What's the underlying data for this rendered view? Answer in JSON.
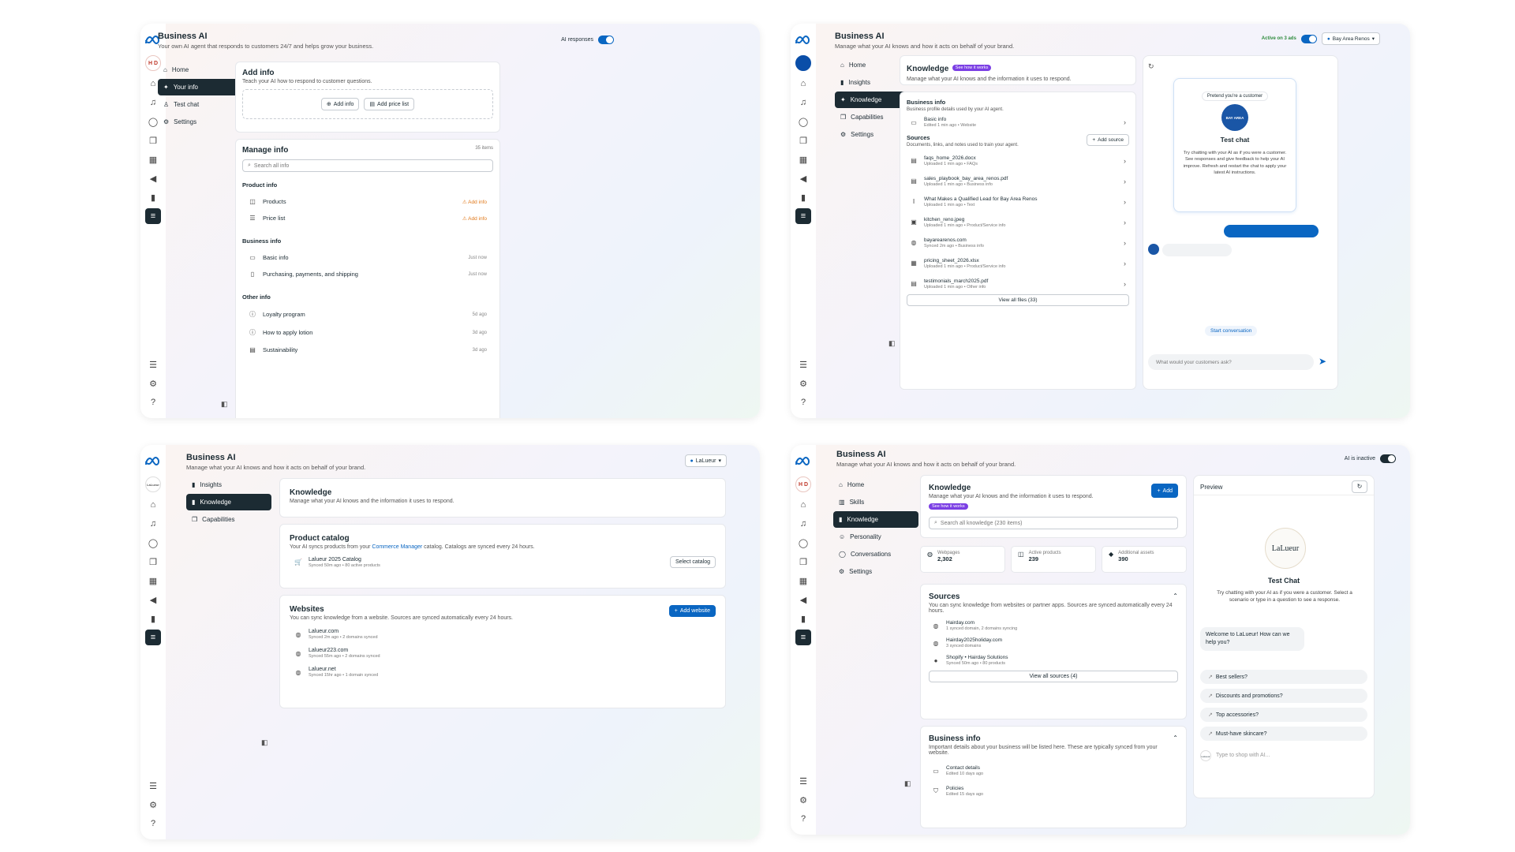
{
  "rail": {
    "avatar": "H D",
    "avatar_p3": "LaLueur"
  },
  "p1": {
    "title": "Business AI",
    "subtitle": "Your own AI agent that responds to customers 24/7 and helps grow your business.",
    "toggle_label": "AI responses",
    "nav": [
      "Home",
      "Your info",
      "Test chat",
      "Settings"
    ],
    "add_info": {
      "title": "Add info",
      "subtitle": "Teach your AI how to respond to customer questions.",
      "btn1": "Add info",
      "btn2": "Add price list"
    },
    "manage": {
      "title": "Manage info",
      "count": "35 items",
      "search": "Search all info",
      "sec1": "Product info",
      "products": "Products",
      "price_list": "Price list",
      "add_info": "Add info",
      "sec2": "Business info",
      "basic": "Basic info",
      "purchasing": "Purchasing, payments, and shipping",
      "just_now": "Just now",
      "sec3": "Other info",
      "loyalty": "Loyalty program",
      "loyalty_t": "5d ago",
      "lotion": "How to apply lotion",
      "lotion_t": "3d ago",
      "sust": "Sustainability",
      "sust_t": "3d ago"
    }
  },
  "p2": {
    "title": "Business AI",
    "subtitle": "Manage what your AI knows and how it acts on behalf of your brand.",
    "active": "Active on 3 ads",
    "page": "Bay Area Renos",
    "nav": [
      "Home",
      "Insights",
      "Knowledge",
      "Capabilities",
      "Settings"
    ],
    "knowledge": {
      "title": "Knowledge",
      "pill": "See how it works",
      "subtitle": "Manage what your AI knows and the information it uses to respond."
    },
    "bizinfo": {
      "title": "Business info",
      "subtitle": "Business profile details used by your AI agent.",
      "basic": "Basic info",
      "basic_sub": "Edited 1 min ago • Website"
    },
    "sources": {
      "title": "Sources",
      "subtitle": "Documents, links, and notes used to train your agent.",
      "add": "Add source",
      "items": [
        {
          "name": "faqs_home_2026.docx",
          "sub": "Uploaded 1 min ago • FAQs"
        },
        {
          "name": "sales_playbook_bay_area_renos.pdf",
          "sub": "Uploaded 1 min ago • Business info"
        },
        {
          "name": "What Makes a Qualified Lead for Bay Area Renos",
          "sub": "Uploaded 1 min ago • Text"
        },
        {
          "name": "kitchen_reno.jpeg",
          "sub": "Uploaded 1 min ago • Product/Service info"
        },
        {
          "name": "bayarearenos.com",
          "sub": "Synced 2m ago • Business info"
        },
        {
          "name": "pricing_sheet_2026.xlsx",
          "sub": "Uploaded 1 min ago • Product/Service info"
        },
        {
          "name": "testimonials_march2025.pdf",
          "sub": "Uploaded 1 min ago • Other info"
        }
      ],
      "view_all": "View all files (33)"
    },
    "chat": {
      "pretend": "Pretend you're a customer",
      "brand": "BAY AREA",
      "title": "Test chat",
      "desc": "Try chatting with your AI as if you were a customer. See responses and give feedback to help your AI improve. Refresh and restart the chat to apply your latest AI instructions.",
      "start": "Start conversation",
      "input": "What would your customers ask?"
    }
  },
  "p3": {
    "title": "Business AI",
    "subtitle": "Manage what your AI knows and how it acts on behalf of your brand.",
    "page": "LaLueur",
    "nav": [
      "Insights",
      "Knowledge",
      "Capabilities"
    ],
    "knowledge": {
      "title": "Knowledge",
      "subtitle": "Manage what your AI knows and the information it uses to respond."
    },
    "catalog": {
      "title": "Product catalog",
      "sub_a": "Your AI syncs products from your ",
      "link": "Commerce Manager",
      "sub_b": " catalog. Catalogs are synced every 24 hours.",
      "name": "Lalueur 2025 Catalog",
      "meta": "Synced 50m ago • 80 active products",
      "btn": "Select catalog"
    },
    "websites": {
      "title": "Websites",
      "subtitle": "You can sync knowledge from a website. Sources are synced automatically every 24 hours.",
      "btn": "Add website",
      "items": [
        {
          "name": "Lalueur.com",
          "sub": "Synced 2m ago • 2 domains synced"
        },
        {
          "name": "Lalueur223.com",
          "sub": "Synced 55m ago • 2 domains synced"
        },
        {
          "name": "Lalueur.net",
          "sub": "Synced 15hr ago • 1 domain synced"
        }
      ]
    }
  },
  "p4": {
    "title": "Business AI",
    "subtitle": "Manage what your AI knows and how it acts on behalf of your brand.",
    "inactive": "AI is inactive",
    "nav": [
      "Home",
      "Skills",
      "Knowledge",
      "Personality",
      "Conversations",
      "Settings"
    ],
    "knowledge": {
      "title": "Knowledge",
      "subtitle": "Manage what your AI knows and the information it uses to respond.",
      "pill": "See how it works",
      "add": "Add",
      "search": "Search all knowledge (230 items)"
    },
    "stats": [
      {
        "label": "Webpages",
        "value": "2,302"
      },
      {
        "label": "Active products",
        "value": "239"
      },
      {
        "label": "Additional assets",
        "value": "390"
      }
    ],
    "sources": {
      "title": "Sources",
      "subtitle": "You can sync knowledge from websites or partner apps. Sources are synced automatically every 24 hours.",
      "items": [
        {
          "name": "Hairday.com",
          "sub": "1 synced domain, 2 domains syncing"
        },
        {
          "name": "Hairday2025holiday.com",
          "sub": "3 synced domains"
        },
        {
          "name": "Shopify • Hairday Solutions",
          "sub": "Synced 50m ago • 80 products"
        }
      ],
      "view_all": "View all sources (4)"
    },
    "bizinfo": {
      "title": "Business info",
      "subtitle": "Important details about your business will be listed here. These are typically synced from your website.",
      "items": [
        {
          "name": "Contact details",
          "sub": "Edited 10 days ago"
        },
        {
          "name": "Policies",
          "sub": "Edited 15 days ago"
        }
      ]
    },
    "preview": {
      "title": "Preview",
      "brand": "LaLueur",
      "chat_title": "Test Chat",
      "desc": "Try chatting with your AI as if you were a customer. Select a scenario or type in a question to see a response.",
      "welcome": "Welcome to LaLueur! How can we help you?",
      "suggestions": [
        "Best sellers?",
        "Discounts and promotions?",
        "Top accessories?",
        "Must-have skincare?"
      ],
      "input": "Type to shop with AI..."
    }
  }
}
